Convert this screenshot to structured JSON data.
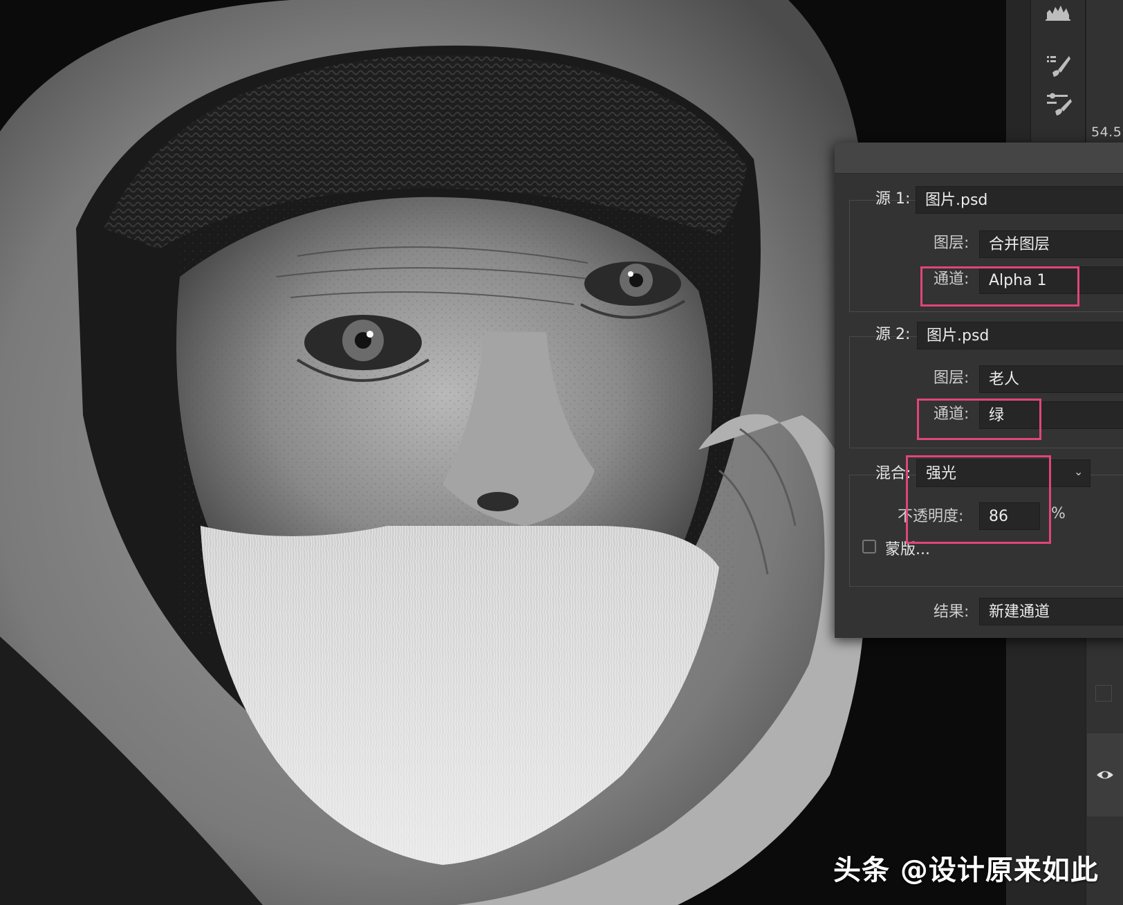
{
  "toolbar": {
    "icons": [
      "histogram-icon",
      "brush-presets-icon",
      "brush-settings-icon"
    ]
  },
  "status": {
    "zoom_readout": "54.5"
  },
  "apply_image_dialog": {
    "source1": {
      "label": "源 1:",
      "file": "图片.psd",
      "layer_label": "图层:",
      "layer_value": "合并图层",
      "channel_label": "通道:",
      "channel_value": "Alpha 1"
    },
    "source2": {
      "label": "源 2:",
      "file": "图片.psd",
      "layer_label": "图层:",
      "layer_value": "老人",
      "channel_label": "通道:",
      "channel_value": "绿"
    },
    "blending": {
      "label": "混合:",
      "value": "强光",
      "opacity_label": "不透明度:",
      "opacity_value": "86",
      "opacity_unit": "%",
      "mask_label": "蒙版...",
      "mask_checked": false
    },
    "result": {
      "label": "结果:",
      "value": "新建通道"
    },
    "highlight_color": "#e2457a"
  },
  "watermark": "头条 @设计原来如此"
}
